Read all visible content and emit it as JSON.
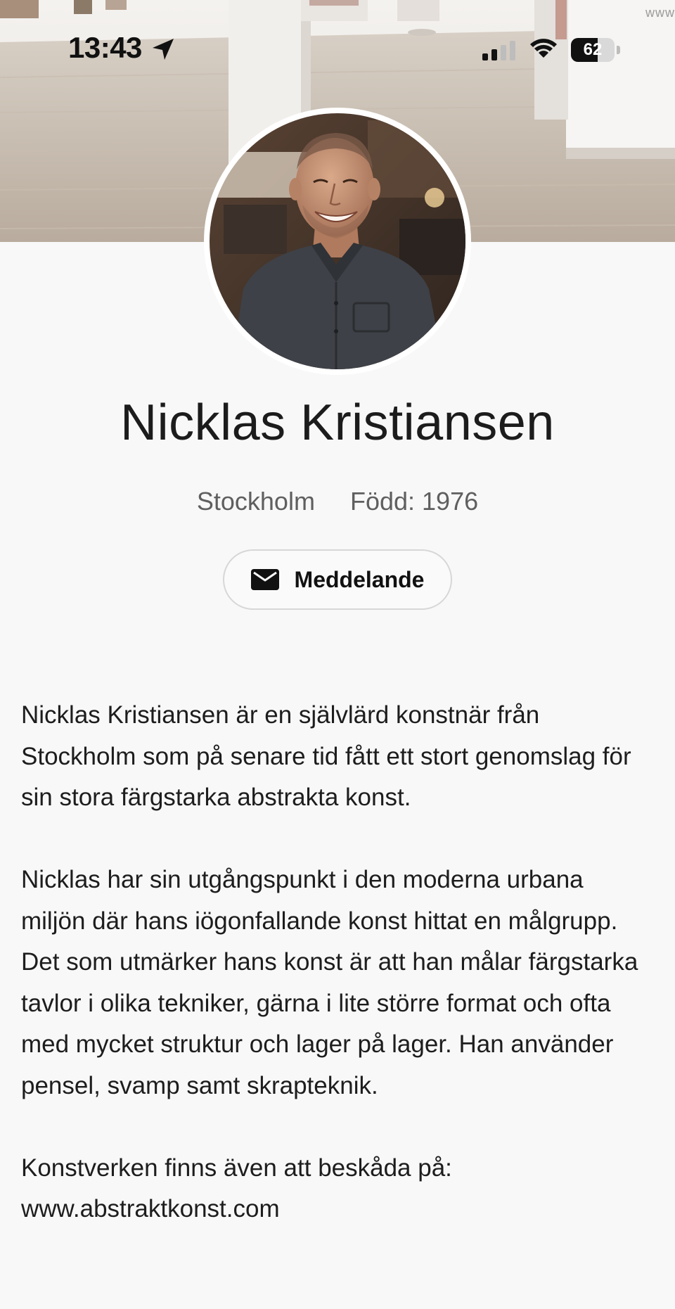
{
  "status_bar": {
    "time": "13:43",
    "battery_level": "62",
    "battery_fraction": 0.62,
    "url_corner": "www"
  },
  "profile": {
    "name": "Nicklas Kristiansen",
    "city": "Stockholm",
    "born": "Född: 1976",
    "message_button_label": "Meddelande",
    "message_icon": "mail-icon"
  },
  "bio": {
    "paragraph_1": "Nicklas Kristiansen är en självlärd konstnär från Stockholm som på senare tid fått ett stort genomslag för sin stora färgstarka abstrakta konst.",
    "paragraph_2": "Nicklas har sin utgångspunkt i den moderna urbana miljön där hans iögonfallande konst hittat en målgrupp. Det som utmärker hans konst är att han målar färgstarka tavlor i olika tekniker, gärna i lite större format och ofta med mycket struktur och lager på lager. Han använder pensel, svamp samt skrapteknik.",
    "paragraph_3_intro": "Konstverken finns även att beskåda på:",
    "website": "www.abstraktkonst.com"
  },
  "colors": {
    "background": "#f8f8f8",
    "text": "#1d1d1d",
    "muted_text": "#5f5f5f",
    "button_border": "#d7d7d7"
  }
}
